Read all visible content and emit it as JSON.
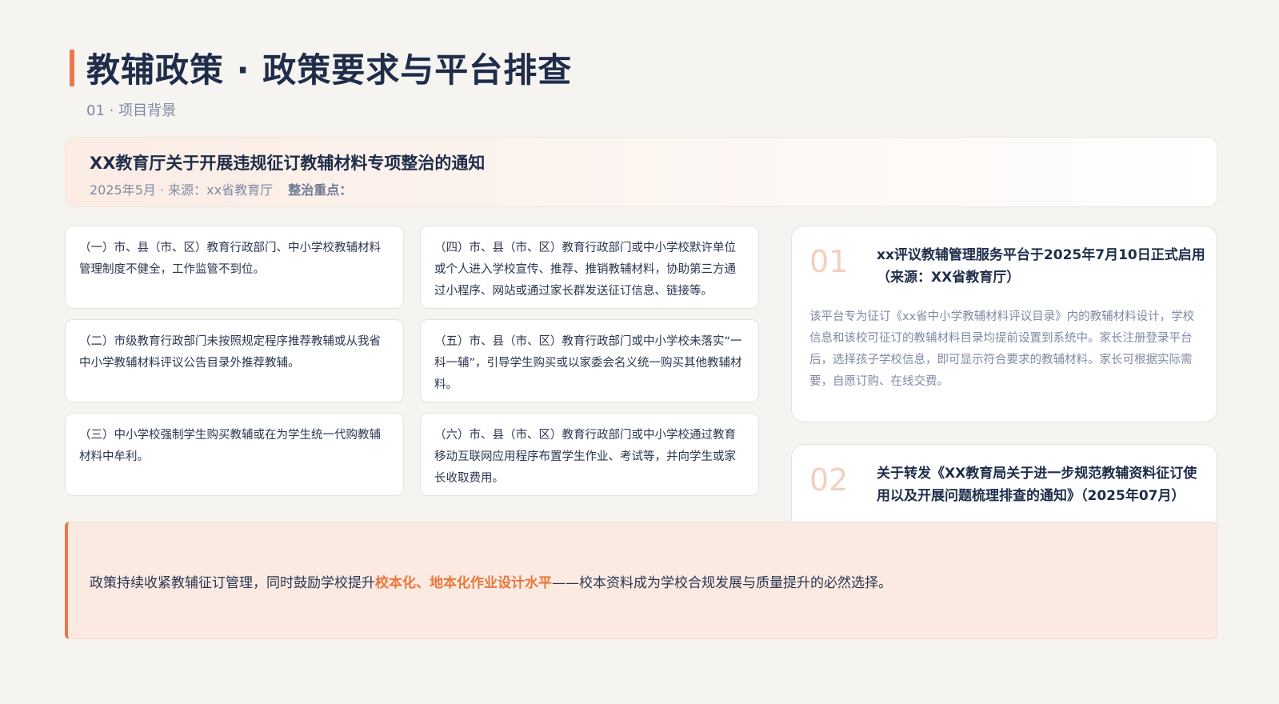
{
  "header": {
    "title": "教辅政策 · 政策要求与平台排查",
    "subtitle": "01 · 项目背景"
  },
  "notice": {
    "title": "XX教育厅关于开展违规征订教辅材料专项整治的通知",
    "meta": "2025年5月 · 来源：xx省教育厅",
    "focus_label": "整治重点："
  },
  "items": [
    "（一）市、县（市、区）教育行政部门、中小学校教辅材料管理制度不健全，工作监管不到位。",
    "（二）市级教育行政部门未按照规定程序推荐教辅或从我省中小学教辅材料评议公告目录外推荐教辅。",
    "（三）中小学校强制学生购买教辅或在为学生统一代购教辅材料中牟利。",
    "（四）市、县（市、区）教育行政部门或中小学校默许单位或个人进入学校宣传、推荐、推销教辅材料，协助第三方通过小程序、网站或通过家长群发送征订信息、链接等。",
    "（五）市、县（市、区）教育行政部门或中小学校未落实“一科一辅”，引导学生购买或以家委会名义统一购买其他教辅材料。",
    "（六）市、县（市、区）教育行政部门或中小学校通过教育移动互联网应用程序布置学生作业、考试等，并向学生或家长收取费用。"
  ],
  "side_cards": [
    {
      "number": "01",
      "title": "xx评议教辅管理服务平台于2025年7月10日正式启用（来源：XX省教育厅）",
      "description": "该平台专为征订《xx省中小学教辅材料评议目录》内的教辅材料设计，学校信息和该校可征订的教辅材料目录均提前设置到系统中。家长注册登录平台后，选择孩子学校信息，即可显示符合要求的教辅材料。家长可根据实际需要，自愿订购、在线交费。"
    },
    {
      "number": "02",
      "title": "关于转发《XX教育局关于进一步规范教辅资料征订使用以及开展问题梳理排查的通知》（2025年07月）"
    }
  ],
  "summary": {
    "prefix": "政策持续收紧教辅征订管理，同时鼓励学校提升",
    "highlight": "校本化、地本化作业设计水平",
    "suffix": "——校本资料成为学校合规发展与质量提升的必然选择。"
  },
  "colors": {
    "accent": "#e8784a",
    "navy": "#1f2d4a",
    "muted": "#7f8aa3",
    "number": "#f3cfbd"
  }
}
